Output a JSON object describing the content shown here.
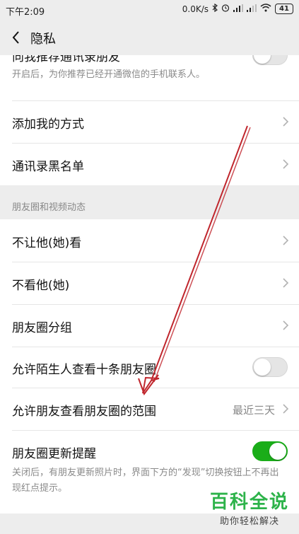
{
  "status_bar": {
    "time": "下午2:09",
    "network_speed": "0.0K/s",
    "battery": "41"
  },
  "nav": {
    "title": "隐私"
  },
  "top_section": {
    "partial_label": "向我推荐通讯录朋友",
    "partial_desc": "开启后，为你推荐已经开通微信的手机联系人。"
  },
  "contacts": {
    "add_method": "添加我的方式",
    "blacklist": "通讯录黑名单"
  },
  "moments": {
    "header": "朋友圈和视频动态",
    "hide_from": "不让他(她)看",
    "ignore": "不看他(她)",
    "groups": "朋友圈分组",
    "stranger_view": "允许陌生人查看十条朋友圈",
    "visible_range": "允许朋友查看朋友圈的范围",
    "visible_range_value": "最近三天",
    "update_reminder": "朋友圈更新提醒",
    "update_reminder_desc": "关闭后，有朋友更新照片时，界面下方的“发现”切换按钮上不再出现红点提示。"
  },
  "watermark": {
    "main": "百科全说",
    "sub": "助你轻松解决"
  },
  "colors": {
    "toggle_on": "#1aad19",
    "annotation_arrow": "#c0262d",
    "watermark": "#2db34a"
  }
}
